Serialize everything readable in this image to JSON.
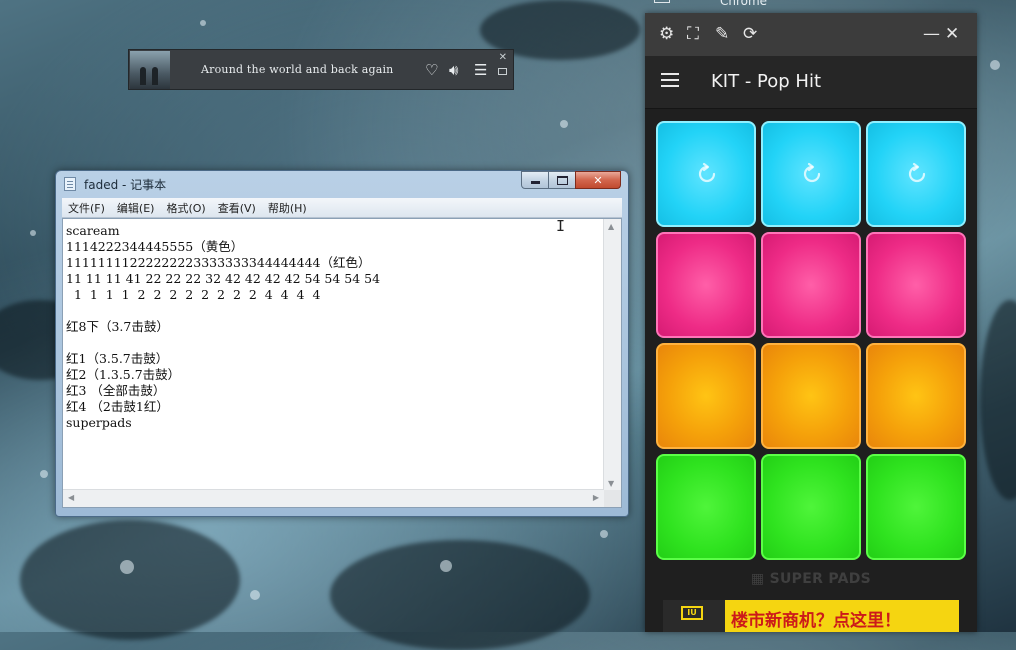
{
  "taskbar_peek": {
    "label": "Chrome"
  },
  "media_player": {
    "track_title": "Around the world and back again",
    "icons": [
      "heart-icon",
      "volume-icon",
      "playlist-icon",
      "close-icon",
      "miniplayer-icon"
    ]
  },
  "notepad": {
    "title": "faded - 记事本",
    "controls": {
      "close": "✕"
    },
    "menu": [
      "文件(F)",
      "编辑(E)",
      "格式(O)",
      "查看(V)",
      "帮助(H)"
    ],
    "content": "scaream\n1114222344445555（黄色）\n11111111222222223333333344444444（红色）\n11 11 11 41 22 22 22 32 42 42 42 42 54 54 54 54\n  1  1  1  1  2  2  2  2  2  2  2  2  4  4  4  4\n\n红8下（3.7击鼓）\n\n红1（3.5.7击鼓）\n红2（1.3.5.7击鼓）\n红3 （全部击鼓）\n红4 （2击鼓1红）\nsuperpads"
  },
  "super_pads": {
    "toolbar_icons": [
      "settings-icon",
      "fullscreen-icon",
      "edit-icon",
      "rotate-icon",
      "minimize-icon",
      "close-icon"
    ],
    "kit_title": "KIT - Pop Hit",
    "pads": [
      {
        "color": "cyan",
        "loop": true
      },
      {
        "color": "cyan",
        "loop": true
      },
      {
        "color": "cyan",
        "loop": true
      },
      {
        "color": "pink",
        "loop": false
      },
      {
        "color": "pink",
        "loop": false
      },
      {
        "color": "pink",
        "loop": false
      },
      {
        "color": "orange",
        "loop": false
      },
      {
        "color": "orange",
        "loop": false
      },
      {
        "color": "orange",
        "loop": false
      },
      {
        "color": "green",
        "loop": false
      },
      {
        "color": "green",
        "loop": false
      },
      {
        "color": "green",
        "loop": false
      }
    ],
    "brand": "SUPER PADS",
    "ad": {
      "logo": "IU",
      "text": "楼市新商机？点这里！"
    }
  }
}
